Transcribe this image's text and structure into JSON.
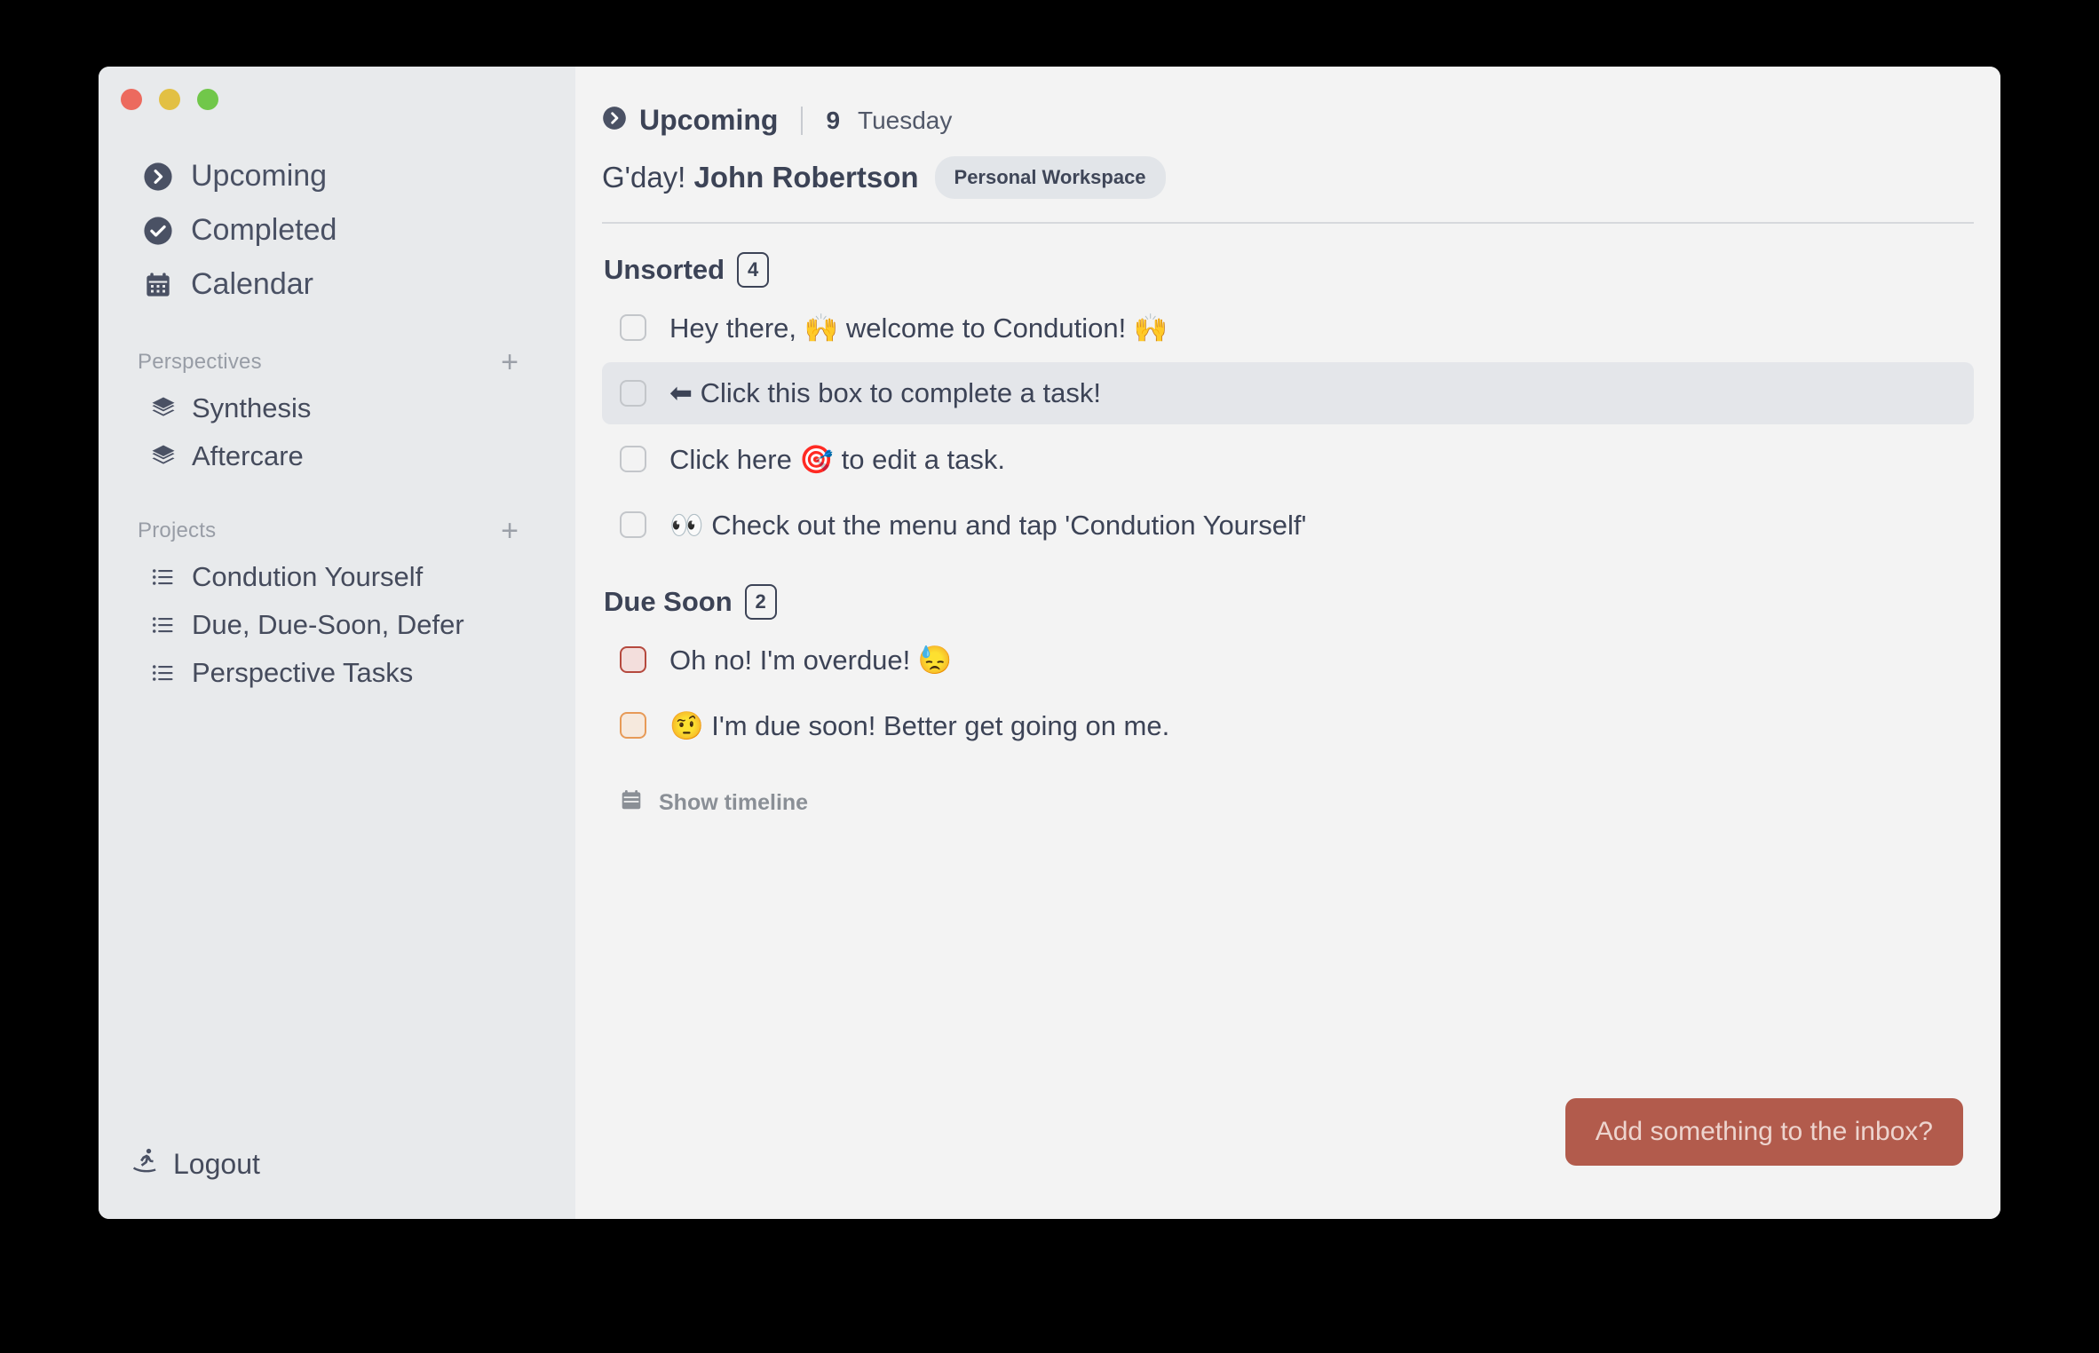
{
  "window": {
    "traffic_lights": [
      "close",
      "minimize",
      "maximize"
    ],
    "colors": {
      "close": "#ec6a5e",
      "minimize": "#e2c044",
      "maximize": "#71c74a",
      "accent": "#b25b4c",
      "text": "#3c4356",
      "sidebar_bg": "#e8eaec",
      "main_bg": "#f3f3f3"
    }
  },
  "sidebar": {
    "nav": [
      {
        "label": "Upcoming",
        "icon": "chevron-right-circle-icon"
      },
      {
        "label": "Completed",
        "icon": "check-circle-icon"
      },
      {
        "label": "Calendar",
        "icon": "calendar-icon"
      }
    ],
    "perspectives": {
      "title": "Perspectives",
      "add_label": "+",
      "items": [
        {
          "label": "Synthesis",
          "icon": "layers-icon"
        },
        {
          "label": "Aftercare",
          "icon": "layers-icon"
        }
      ]
    },
    "projects": {
      "title": "Projects",
      "add_label": "+",
      "items": [
        {
          "label": "Condution Yourself",
          "icon": "list-icon"
        },
        {
          "label": "Due, Due-Soon, Defer",
          "icon": "list-icon"
        },
        {
          "label": "Perspective Tasks",
          "icon": "list-icon"
        }
      ]
    },
    "logout": {
      "label": "Logout",
      "icon": "snowboarder-icon"
    }
  },
  "header": {
    "breadcrumb_icon": "chevron-right-circle-icon",
    "breadcrumb": "Upcoming",
    "date_number": "9",
    "date_day": "Tuesday",
    "greeting_prefix": "G'day!",
    "user_name": "John Robertson",
    "workspace_chip": "Personal Workspace"
  },
  "sections": [
    {
      "title": "Unsorted",
      "count": "4",
      "tasks": [
        {
          "text": "Hey there, 🙌 welcome to Condution! 🙌",
          "state": "normal",
          "selected": false
        },
        {
          "text": "⬅ Click this box to complete a task!",
          "state": "normal",
          "selected": true
        },
        {
          "text": "Click here 🎯 to edit a task.",
          "state": "normal",
          "selected": false
        },
        {
          "text": "👀 Check out the menu and tap 'Condution Yourself'",
          "state": "normal",
          "selected": false
        }
      ]
    },
    {
      "title": "Due Soon",
      "count": "2",
      "tasks": [
        {
          "text": "Oh no! I'm overdue! 😓",
          "state": "overdue",
          "selected": false
        },
        {
          "text": "🤨 I'm due soon! Better get going on me.",
          "state": "duesoon",
          "selected": false
        }
      ]
    }
  ],
  "timeline": {
    "label": "Show timeline",
    "icon": "calendar-icon"
  },
  "inbox_button": {
    "label": "Add something to the inbox?"
  }
}
